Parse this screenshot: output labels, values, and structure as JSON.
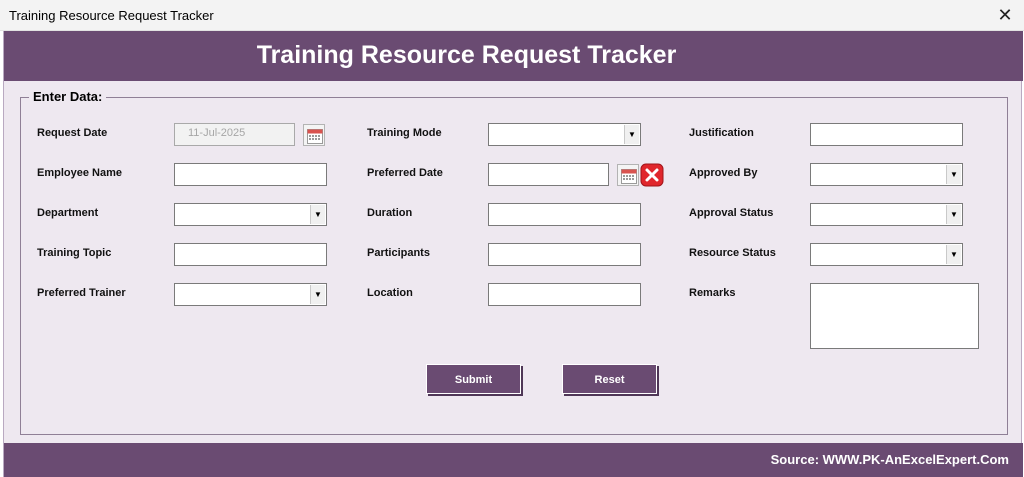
{
  "window": {
    "title": "Training Resource Request Tracker",
    "close_glyph": "✕"
  },
  "header": {
    "title": "Training Resource Request Tracker"
  },
  "frame": {
    "legend": "Enter Data:"
  },
  "fields": {
    "request_date": {
      "label": "Request Date",
      "value": "11-Jul-2025"
    },
    "employee_name": {
      "label": "Employee Name",
      "value": ""
    },
    "department": {
      "label": "Department",
      "value": ""
    },
    "training_topic": {
      "label": "Training Topic",
      "value": ""
    },
    "preferred_trainer": {
      "label": "Preferred Trainer",
      "value": ""
    },
    "training_mode": {
      "label": "Training Mode",
      "value": ""
    },
    "preferred_date": {
      "label": "Preferred Date",
      "value": ""
    },
    "duration": {
      "label": "Duration",
      "value": ""
    },
    "participants": {
      "label": "Participants",
      "value": ""
    },
    "location": {
      "label": "Location",
      "value": ""
    },
    "justification": {
      "label": "Justification",
      "value": ""
    },
    "approved_by": {
      "label": "Approved By",
      "value": ""
    },
    "approval_status": {
      "label": "Approval Status",
      "value": ""
    },
    "resource_status": {
      "label": "Resource Status",
      "value": ""
    },
    "remarks": {
      "label": "Remarks",
      "value": ""
    }
  },
  "buttons": {
    "submit": "Submit",
    "reset": "Reset"
  },
  "footer": {
    "source": "Source: WWW.PK-AnExcelExpert.Com"
  },
  "icons": {
    "calendar": "calendar-icon",
    "clear": "clear-date-icon",
    "dropdown": "dropdown-arrow-icon"
  },
  "colors": {
    "brand": "#6a4b72",
    "form_bg": "#eee8f0",
    "clear_red": "#e0262c"
  }
}
